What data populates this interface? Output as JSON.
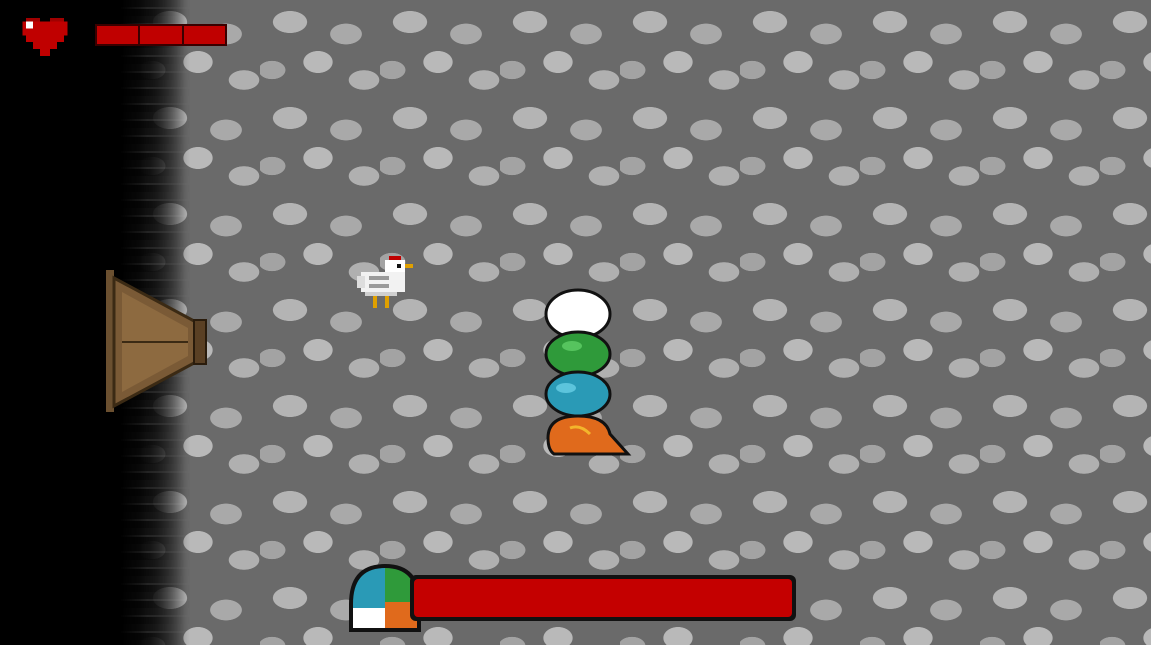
{
  "scene": {
    "name": "dungeon-room"
  },
  "hud": {
    "player": {
      "icon": "heart-icon",
      "health_segments_total": 3,
      "health_segments_filled": 3
    },
    "boss": {
      "portrait": "rainbow-slime-portrait",
      "health_fraction": 1.0
    }
  },
  "entities": {
    "chicken": "chicken-sprite",
    "slime_stack": [
      "white-slime",
      "green-slime",
      "blue-slime",
      "orange-slime"
    ]
  },
  "colors": {
    "health_red": "#c00000",
    "floor_gray": "#8e8e8e",
    "door_brown": "#6b5030"
  }
}
